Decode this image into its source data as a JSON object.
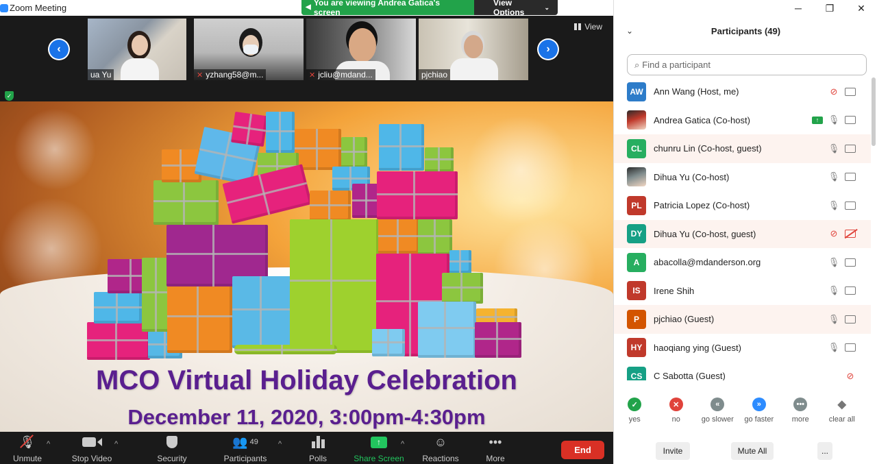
{
  "window": {
    "title": "Zoom Meeting"
  },
  "banner": {
    "viewing_text": "You are viewing Andrea Gatica's screen",
    "view_options": "View Options"
  },
  "strip": {
    "view_label": "View",
    "thumbnails": [
      {
        "name": "ua Yu",
        "muted": false
      },
      {
        "name": "yzhang58@m...",
        "muted": true
      },
      {
        "name": "jcliu@mdand...",
        "muted": true
      },
      {
        "name": "pjchiao",
        "muted": false
      }
    ]
  },
  "shared_slide": {
    "headline": "MCO Virtual Holiday Celebration",
    "subheadline": "December 11, 2020, 3:00pm-4:30pm"
  },
  "toolbar": {
    "unmute": "Unmute",
    "stop_video": "Stop Video",
    "security": "Security",
    "participants": "Participants",
    "participants_count": "49",
    "polls": "Polls",
    "share_screen": "Share Screen",
    "reactions": "Reactions",
    "more": "More",
    "end": "End"
  },
  "panel": {
    "title": "Participants (49)",
    "search_placeholder": "Find a participant",
    "participants": [
      {
        "initials": "AW",
        "name": "Ann Wang (Host, me)",
        "color": "#2d7cc9",
        "mic": "off",
        "cam": "on",
        "sharing": false,
        "photo": false,
        "highlight": false
      },
      {
        "initials": "",
        "name": "Andrea Gatica (Co-host)",
        "color": "#c0392b",
        "mic": "on",
        "cam": "on",
        "sharing": true,
        "photo": true,
        "highlight": false
      },
      {
        "initials": "CL",
        "name": "chunru Lin (Co-host, guest)",
        "color": "#27ae60",
        "mic": "on",
        "cam": "on",
        "sharing": false,
        "photo": false,
        "highlight": true
      },
      {
        "initials": "",
        "name": "Dihua Yu (Co-host)",
        "color": "#7f8c8d",
        "mic": "on",
        "cam": "on",
        "sharing": false,
        "photo": true,
        "highlight": false
      },
      {
        "initials": "PL",
        "name": "Patricia Lopez (Co-host)",
        "color": "#c0392b",
        "mic": "on",
        "cam": "on",
        "sharing": false,
        "photo": false,
        "highlight": false
      },
      {
        "initials": "DY",
        "name": "Dihua Yu (Co-host, guest)",
        "color": "#16a085",
        "mic": "off",
        "cam": "off",
        "sharing": false,
        "photo": false,
        "highlight": true
      },
      {
        "initials": "A",
        "name": "abacolla@mdanderson.org",
        "color": "#27ae60",
        "mic": "on",
        "cam": "on",
        "sharing": false,
        "photo": false,
        "highlight": false
      },
      {
        "initials": "IS",
        "name": "Irene Shih",
        "color": "#c0392b",
        "mic": "on",
        "cam": "on",
        "sharing": false,
        "photo": false,
        "highlight": false
      },
      {
        "initials": "P",
        "name": "pjchiao (Guest)",
        "color": "#d35400",
        "mic": "on",
        "cam": "on",
        "sharing": false,
        "photo": false,
        "highlight": true
      },
      {
        "initials": "HY",
        "name": "haoqiang ying (Guest)",
        "color": "#c0392b",
        "mic": "on",
        "cam": "on",
        "sharing": false,
        "photo": false,
        "highlight": false
      },
      {
        "initials": "CS",
        "name": "C Sabotta (Guest)",
        "color": "#16a085",
        "mic": "off",
        "cam": "none",
        "sharing": false,
        "photo": false,
        "highlight": false
      }
    ],
    "feedback": [
      {
        "label": "yes",
        "symbol": "✓",
        "color": "#22a34a"
      },
      {
        "label": "no",
        "symbol": "✕",
        "color": "#e0433b"
      },
      {
        "label": "go slower",
        "symbol": "«",
        "color": "#7f8c8d"
      },
      {
        "label": "go faster",
        "symbol": "»",
        "color": "#2d8cff"
      },
      {
        "label": "more",
        "symbol": "•••",
        "color": "#7f8c8d"
      },
      {
        "label": "clear all",
        "symbol": "◆",
        "color": "#ffffff"
      }
    ],
    "invite": "Invite",
    "mute_all": "Mute All",
    "more_dots": "..."
  }
}
